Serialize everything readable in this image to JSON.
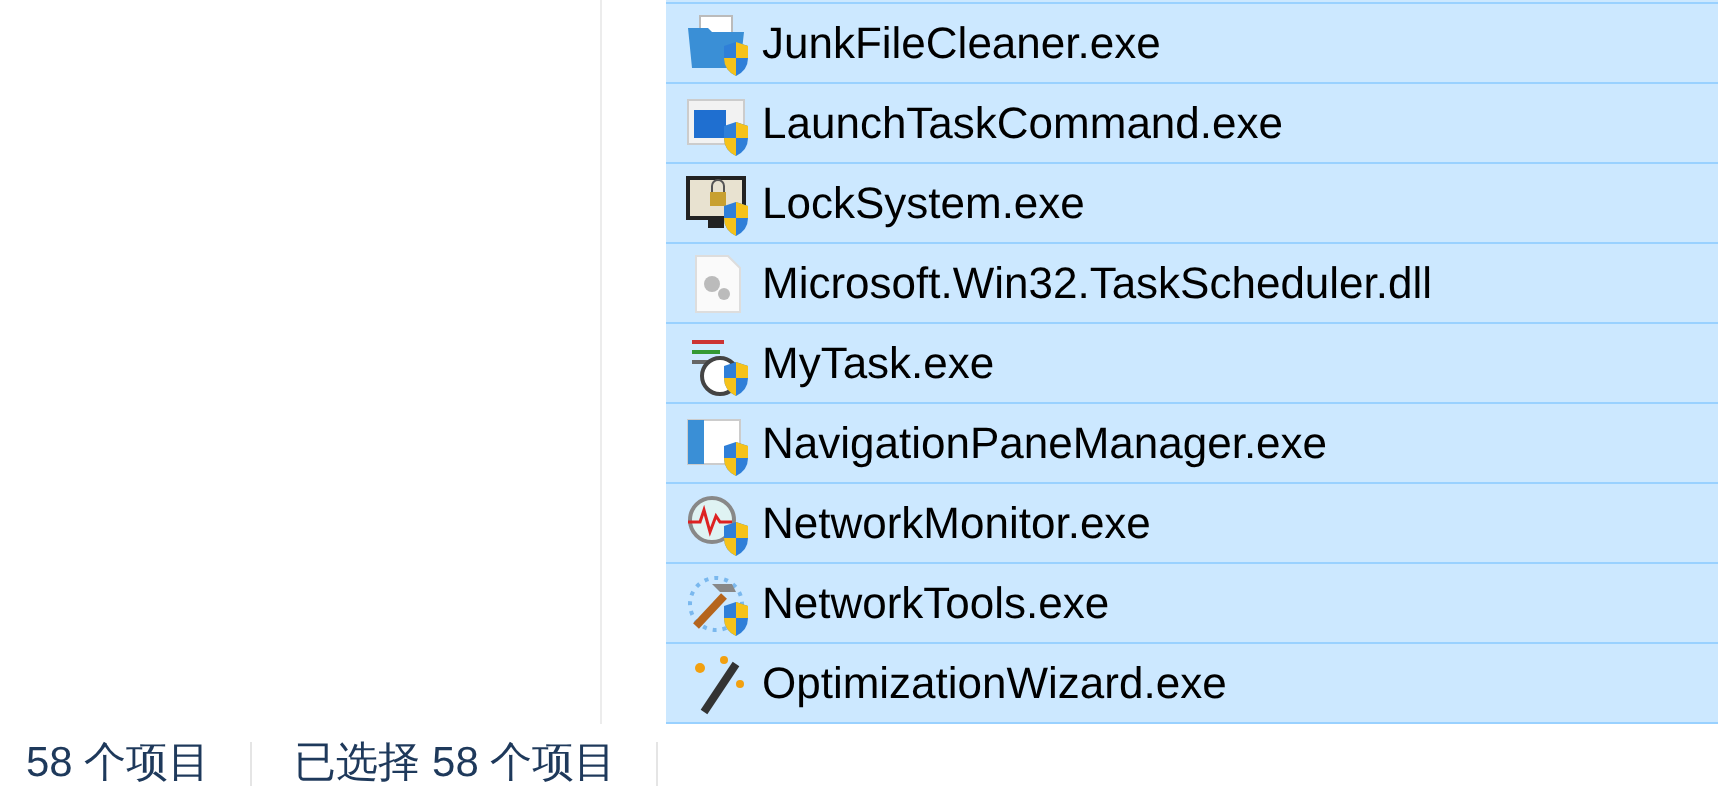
{
  "files": [
    {
      "name": "JunkFileCleaner.exe",
      "kind": "folder",
      "selected": true
    },
    {
      "name": "LaunchTaskCommand.exe",
      "kind": "window",
      "selected": true
    },
    {
      "name": "LockSystem.exe",
      "kind": "lock",
      "selected": true
    },
    {
      "name": "Microsoft.Win32.TaskScheduler.dll",
      "kind": "dll",
      "selected": true
    },
    {
      "name": "MyTask.exe",
      "kind": "task",
      "selected": true
    },
    {
      "name": "NavigationPaneManager.exe",
      "kind": "pane",
      "selected": true
    },
    {
      "name": "NetworkMonitor.exe",
      "kind": "monitor",
      "selected": true
    },
    {
      "name": "NetworkTools.exe",
      "kind": "tools",
      "selected": true
    },
    {
      "name": "OptimizationWizard.exe",
      "kind": "wand",
      "selected": true
    }
  ],
  "status_bar": {
    "item_count": "58 个项目",
    "selection": "已选择 58 个项目"
  }
}
